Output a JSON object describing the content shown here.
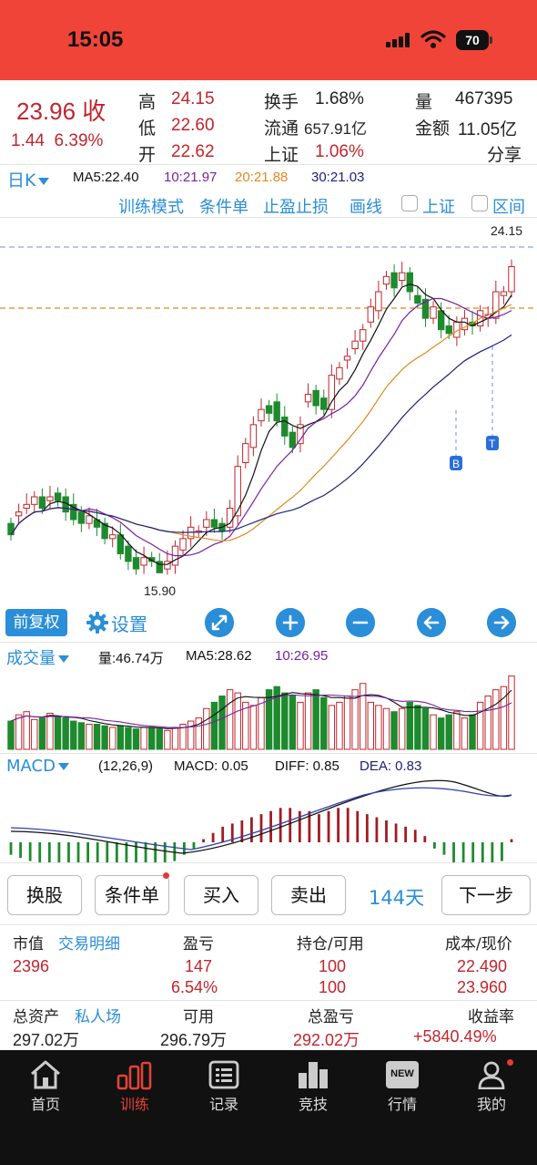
{
  "status_bar": {
    "time": "15:05",
    "battery": "70"
  },
  "quote": {
    "price_label": "23.96 收",
    "change": "1.44",
    "change_pct": "6.39%",
    "high_label": "高",
    "high": "24.15",
    "low_label": "低",
    "low": "22.60",
    "open_label": "开",
    "open": "22.62",
    "turnover_label": "换手",
    "turnover": "1.68%",
    "float_label": "流通",
    "float": "657.91亿",
    "index_label": "上证",
    "index": "1.06%",
    "volume_label": "量",
    "volume": "467395",
    "amount_label": "金额",
    "amount": "11.05亿",
    "share_label": "分享"
  },
  "period": {
    "label": "日K"
  },
  "ma": {
    "ma5": "MA5:22.40",
    "ma10": "10:21.97",
    "ma20": "20:21.88",
    "ma30": "30:21.03"
  },
  "tools": {
    "training_mode": "训练模式",
    "conditional": "条件单",
    "tp_sl": "止盈止损",
    "draw": "画线",
    "index_chk": "上证",
    "range_chk": "区间"
  },
  "kline_labels": {
    "high": "24.15",
    "low": "15.90",
    "buy_marker": "B",
    "sell_marker": "T"
  },
  "controls": {
    "adjust": "前复权",
    "settings": "设置"
  },
  "volume_panel": {
    "label": "成交量",
    "vol": "量:46.74万",
    "ma5": "MA5:28.62",
    "ma10": "10:26.95"
  },
  "macd_panel": {
    "label": "MACD",
    "params": "(12,26,9)",
    "macd": "MACD: 0.05",
    "diff": "DIFF: 0.85",
    "dea": "DEA: 0.83"
  },
  "buttons": {
    "swap": "换股",
    "conditional": "条件单",
    "buy": "买入",
    "sell": "卖出",
    "days": "144天",
    "next": "下一步"
  },
  "account": {
    "market_value_label": "市值",
    "trade_detail_label": "交易明细",
    "pnl_label": "盈亏",
    "position_label": "持仓/可用",
    "cost_label": "成本/现价",
    "market_value": "2396",
    "pnl": "147",
    "pnl_pct": "6.54%",
    "position": "100",
    "available": "100",
    "cost": "22.490",
    "current": "23.960",
    "total_assets_label": "总资产",
    "private_room_label": "私人场",
    "usable_label": "可用",
    "total_pnl_label": "总盈亏",
    "return_label": "收益率",
    "total_assets": "297.02万",
    "usable": "296.79万",
    "total_pnl": "292.02万",
    "return_rate": "+5840.49%"
  },
  "nav": {
    "items": [
      {
        "label": "首页",
        "icon": "home-icon"
      },
      {
        "label": "训练",
        "icon": "bar-chart-icon"
      },
      {
        "label": "记录",
        "icon": "list-icon"
      },
      {
        "label": "竞技",
        "icon": "podium-icon"
      },
      {
        "label": "行情",
        "icon": "new-icon",
        "badge": "NEW"
      },
      {
        "label": "我的",
        "icon": "user-icon"
      }
    ]
  },
  "colors": {
    "up": "#c0262d",
    "down": "#1e8a2e",
    "accent": "#2a8ed8",
    "status_bar": "#f04438",
    "ma5": "#111111",
    "ma10": "#7b1fa2",
    "ma20": "#e08a1e",
    "ma30": "#1a237e"
  },
  "chart_data": [
    {
      "type": "candlestick",
      "title": "日K",
      "x": [
        1,
        2,
        3,
        4,
        5,
        6,
        7,
        8,
        9,
        10,
        11,
        12,
        13,
        14,
        15,
        16,
        17,
        18,
        19,
        20,
        21,
        22,
        23,
        24,
        25,
        26,
        27,
        28,
        29,
        30,
        31,
        32,
        33,
        34,
        35,
        36,
        37,
        38,
        39,
        40,
        41,
        42,
        43,
        44,
        45,
        46,
        47,
        48,
        49,
        50,
        51,
        52,
        53,
        54,
        55,
        56,
        57,
        58,
        59,
        60,
        61,
        62,
        63,
        64,
        65,
        66,
        67,
        68,
        69,
        70,
        71,
        72,
        73,
        74,
        75
      ],
      "open": [
        17.2,
        17.4,
        17.6,
        17.7,
        17.9,
        17.8,
        18.0,
        17.9,
        17.7,
        17.5,
        17.2,
        17.3,
        17.2,
        16.8,
        16.9,
        16.6,
        16.3,
        16.1,
        16.3,
        16.2,
        16.0,
        16.1,
        16.5,
        16.8,
        17.0,
        17.1,
        17.3,
        17.2,
        17.1,
        17.4,
        18.8,
        19.2,
        19.9,
        20.3,
        20.4,
        20.0,
        19.6,
        19.3,
        20.4,
        20.7,
        20.5,
        20.2,
        21.0,
        21.5,
        21.8,
        22.0,
        22.5,
        22.8,
        23.5,
        23.8,
        23.6,
        23.8,
        23.2,
        23.1,
        22.6,
        22.8,
        22.4,
        22.1,
        22.3,
        22.5,
        22.4,
        22.6,
        22.6,
        23.2,
        23.3
      ],
      "close": [
        16.9,
        17.5,
        17.7,
        17.9,
        17.6,
        17.9,
        17.8,
        17.5,
        17.3,
        17.2,
        17.4,
        17.1,
        16.8,
        16.9,
        16.4,
        16.2,
        16.0,
        16.3,
        16.2,
        15.9,
        16.2,
        16.6,
        16.8,
        17.1,
        17.0,
        17.3,
        17.1,
        17.0,
        17.6,
        18.7,
        19.3,
        19.8,
        20.2,
        20.1,
        19.9,
        19.5,
        19.2,
        19.8,
        20.6,
        20.3,
        20.2,
        21.1,
        21.3,
        21.6,
        22.0,
        22.3,
        22.9,
        23.3,
        23.7,
        23.4,
        23.8,
        23.3,
        23.0,
        22.6,
        22.9,
        22.3,
        22.2,
        22.5,
        22.6,
        22.4,
        22.8,
        22.7,
        23.3,
        23.3,
        23.96
      ],
      "high": [
        24.15
      ],
      "low": [
        15.9
      ],
      "ylim": [
        15.5,
        24.5
      ]
    },
    {
      "type": "bar",
      "title": "成交量",
      "values": [
        18,
        22,
        24,
        19,
        20,
        23,
        21,
        20,
        18,
        17,
        16,
        16,
        15,
        14,
        15,
        14,
        13,
        14,
        14,
        13,
        12,
        14,
        16,
        18,
        20,
        26,
        30,
        34,
        38,
        36,
        30,
        28,
        33,
        38,
        40,
        36,
        34,
        30,
        36,
        38,
        33,
        28,
        30,
        34,
        38,
        42,
        30,
        28,
        26,
        24,
        26,
        30,
        28,
        26,
        22,
        20,
        22,
        24,
        20,
        22,
        30,
        34,
        38,
        40,
        46.74
      ]
    },
    {
      "type": "bar",
      "title": "MACD",
      "series": [
        {
          "name": "MACD",
          "values": [
            -0.2,
            -0.25,
            -0.3,
            -0.35,
            -0.4,
            -0.45,
            -0.5,
            -0.55,
            -0.6,
            -0.65,
            -0.65,
            -0.6,
            -0.55,
            -0.5,
            -0.45,
            -0.4,
            -0.35,
            -0.3,
            -0.2,
            -0.1,
            0.05,
            0.15,
            0.25,
            0.3,
            0.35,
            0.4,
            0.45,
            0.5,
            0.55,
            0.55,
            0.5,
            0.5,
            0.45,
            0.5,
            0.55,
            0.55,
            0.5,
            0.45,
            0.4,
            0.35,
            0.3,
            0.25,
            0.2,
            0.1,
            -0.1,
            -0.2,
            -0.35,
            -0.4,
            -0.45,
            -0.4,
            -0.35,
            -0.3,
            0.05
          ]
        },
        {
          "name": "DIFF",
          "values": [
            0.85
          ]
        },
        {
          "name": "DEA",
          "values": [
            0.83
          ]
        }
      ]
    }
  ]
}
